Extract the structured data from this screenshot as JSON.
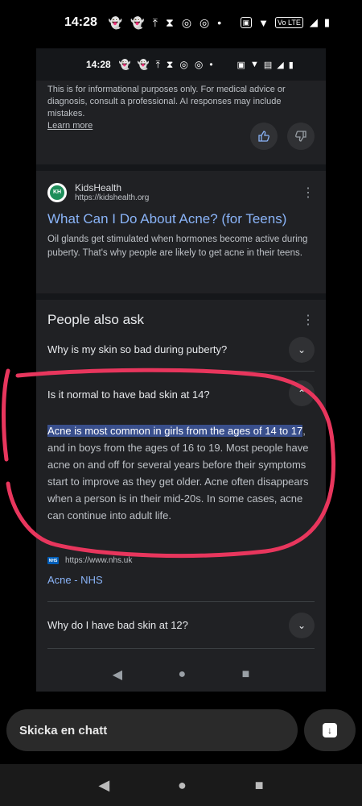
{
  "status_bar": {
    "time": "14:28",
    "dot": "•",
    "lte": "Vo LTE"
  },
  "inner_status": {
    "time": "14:28"
  },
  "disclaimer": {
    "text": "This is for informational purposes only. For medical advice or diagnosis, consult a professional. AI responses may include mistakes.",
    "learn_more": "Learn more"
  },
  "result": {
    "favicon_text": "KH",
    "site_name": "KidsHealth",
    "site_url": "https://kidshealth.org",
    "title": "What Can I Do About Acne? (for Teens)",
    "snippet": "Oil glands get stimulated when hormones become active during puberty. That's why people are likely to get acne in their teens."
  },
  "paa": {
    "title": "People also ask",
    "questions": [
      "Why is my skin so bad during puberty?",
      "Is it normal to have bad skin at 14?",
      "Why do I have bad skin at 12?"
    ],
    "answer_highlight": "Acne is most common in girls from the ages of 14 to 17",
    "answer_rest": ", and in boys from the ages of 16 to 19. Most people have acne on and off for several years before their symptoms start to improve as they get older. Acne often disappears when a person is in their mid-20s. In some cases, acne can continue into adult life.",
    "source_logo": "NHS",
    "source_url": "https://www.nhs.uk",
    "source_link": "Acne - NHS"
  },
  "chat": {
    "placeholder": "Skicka en chatt"
  },
  "colors": {
    "link": "#8ab4f8",
    "highlight": "#394f8c",
    "annotation": "#e8365d"
  }
}
